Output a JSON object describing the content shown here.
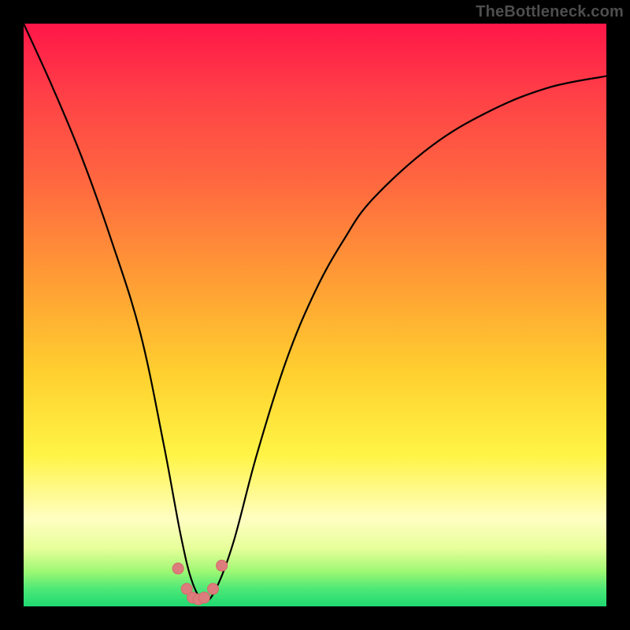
{
  "watermark": "TheBottleneck.com",
  "colors": {
    "frame": "#000000",
    "gradient_top": "#ff1648",
    "gradient_mid": "#ffd02f",
    "gradient_bottom": "#1fd971",
    "curve": "#000000",
    "dots": "#dd7c7c"
  },
  "chart_data": {
    "type": "line",
    "title": "",
    "xlabel": "",
    "ylabel": "",
    "xlim": [
      0,
      100
    ],
    "ylim": [
      0,
      100
    ],
    "series": [
      {
        "name": "bottleneck-curve",
        "x": [
          0,
          5,
          10,
          15,
          20,
          24,
          27,
          29,
          31,
          33,
          36,
          40,
          45,
          50,
          55,
          60,
          70,
          80,
          90,
          100
        ],
        "y": [
          100,
          89,
          77,
          63,
          47,
          28,
          12,
          4,
          1,
          3,
          11,
          26,
          42,
          54,
          63,
          70,
          79,
          85,
          89,
          91
        ]
      }
    ],
    "markers": {
      "name": "highlight-dots",
      "x": [
        26.5,
        28.0,
        29.0,
        30.0,
        31.0,
        32.5,
        34.0
      ],
      "y": [
        6.5,
        3.0,
        1.5,
        1.2,
        1.5,
        3.0,
        7.0
      ]
    },
    "annotations": []
  }
}
